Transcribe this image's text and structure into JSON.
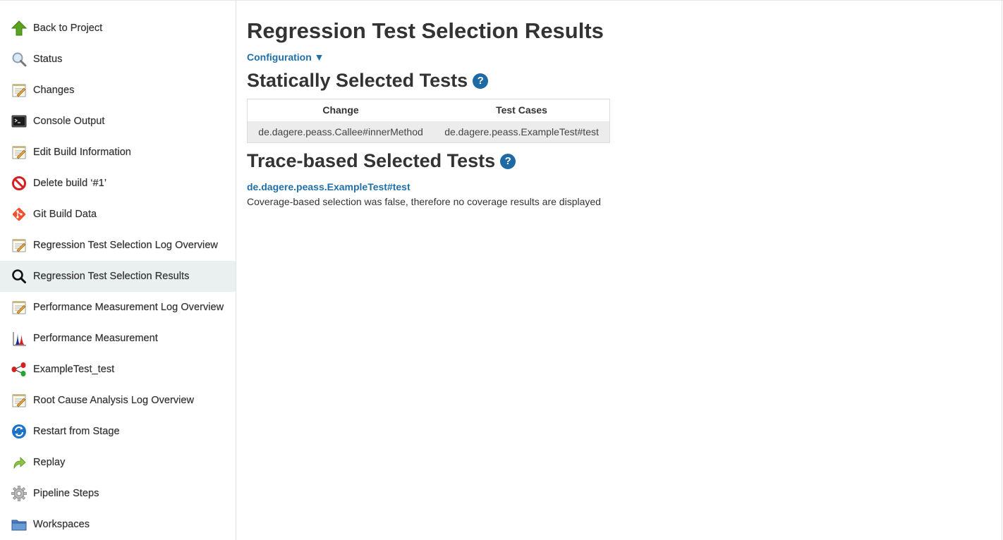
{
  "sidebar": {
    "items": [
      {
        "label": "Back to Project",
        "icon": "arrow-up-icon"
      },
      {
        "label": "Status",
        "icon": "magnifier-icon"
      },
      {
        "label": "Changes",
        "icon": "notepad-icon"
      },
      {
        "label": "Console Output",
        "icon": "terminal-icon"
      },
      {
        "label": "Edit Build Information",
        "icon": "notepad-icon"
      },
      {
        "label": "Delete build ‘#1’",
        "icon": "no-entry-icon"
      },
      {
        "label": "Git Build Data",
        "icon": "git-icon"
      },
      {
        "label": "Regression Test Selection Log Overview",
        "icon": "notepad-icon"
      },
      {
        "label": "Regression Test Selection Results",
        "icon": "search-icon",
        "active": true
      },
      {
        "label": "Performance Measurement Log Overview",
        "icon": "notepad-icon"
      },
      {
        "label": "Performance Measurement",
        "icon": "distribution-chart-icon"
      },
      {
        "label": "ExampleTest_test",
        "icon": "call-tree-icon"
      },
      {
        "label": "Root Cause Analysis Log Overview",
        "icon": "notepad-icon"
      },
      {
        "label": "Restart from Stage",
        "icon": "restart-icon"
      },
      {
        "label": "Replay",
        "icon": "replay-arrow-icon"
      },
      {
        "label": "Pipeline Steps",
        "icon": "gear-icon"
      },
      {
        "label": "Workspaces",
        "icon": "folder-icon"
      }
    ]
  },
  "main": {
    "title": "Regression Test Selection Results",
    "configuration_label": "Configuration ▼",
    "static_section": {
      "title": "Statically Selected Tests",
      "help": "?",
      "columns": [
        "Change",
        "Test Cases"
      ],
      "rows": [
        [
          "de.dagere.peass.Callee#innerMethod",
          "de.dagere.peass.ExampleTest#test"
        ]
      ]
    },
    "trace_section": {
      "title": "Trace-based Selected Tests",
      "help": "?",
      "tests": [
        "de.dagere.peass.ExampleTest#test"
      ],
      "note": "Coverage-based selection was false, therefore no coverage results are displayed"
    }
  },
  "colors": {
    "link": "#1f6fa9",
    "help_badge": "#1d6aa5",
    "active_sidebar": "#eaeff0",
    "table_row": "#ececec"
  }
}
